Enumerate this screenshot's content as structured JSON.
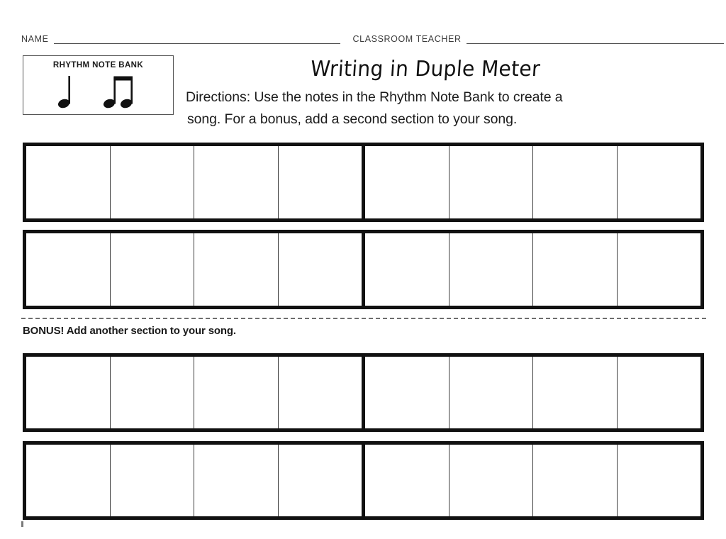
{
  "page": {
    "title": "Writing in Duple Meter",
    "background_color": "#ffffff",
    "ink_color": "#111111"
  },
  "header": {
    "name_label": "NAME",
    "name_value": "",
    "teacher_label": "CLASSROOM TEACHER",
    "teacher_value": ""
  },
  "note_bank": {
    "title": "RHYTHM NOTE BANK",
    "notes": [
      {
        "name": "quarter-note",
        "symbol": "♩",
        "count": 1
      },
      {
        "name": "beamed-eighth-note-pair",
        "symbol": "♫",
        "count": 1
      }
    ]
  },
  "directions": {
    "line1": "Directions: Use the notes in the Rhythm Note Bank to create a",
    "line2": "song. For a bonus, add a second section to your song."
  },
  "bonus": {
    "divider_style": "dashed",
    "divider_color": "#6e6e6e",
    "text": "BONUS! Add another section to your song."
  },
  "staff_rows": [
    {
      "id": "row-1",
      "section": "main",
      "measures_per_half": 4,
      "total_measures": 8,
      "cells": [
        "",
        "",
        "",
        "",
        "",
        "",
        "",
        ""
      ]
    },
    {
      "id": "row-2",
      "section": "main",
      "measures_per_half": 4,
      "total_measures": 8,
      "cells": [
        "",
        "",
        "",
        "",
        "",
        "",
        "",
        ""
      ]
    },
    {
      "id": "row-3",
      "section": "bonus",
      "measures_per_half": 4,
      "total_measures": 8,
      "cells": [
        "",
        "",
        "",
        "",
        "",
        "",
        "",
        ""
      ]
    },
    {
      "id": "row-4",
      "section": "bonus",
      "measures_per_half": 4,
      "total_measures": 8,
      "cells": [
        "",
        "",
        "",
        "",
        "",
        "",
        "",
        ""
      ]
    }
  ]
}
